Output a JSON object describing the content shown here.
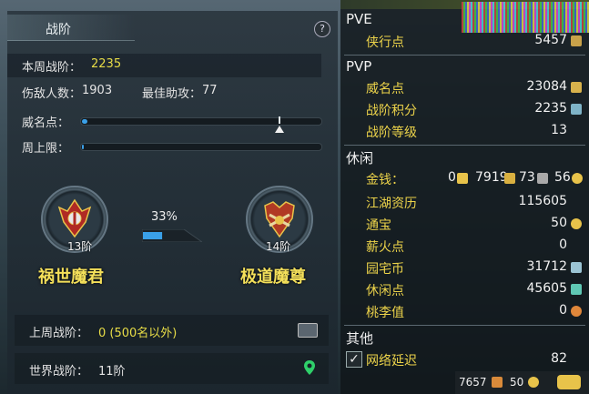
{
  "rank": {
    "title": "战阶",
    "help": "?",
    "this_week_label": "本周战阶：",
    "this_week_value": "2235",
    "kills_label": "伤敌人数：",
    "kills_value": "1903",
    "assists_label": "最佳助攻：",
    "assists_value": "77",
    "prestige_label": "威名点：",
    "weekly_cap_label": "周上限：",
    "left_tier": "13阶",
    "left_name": "祸世魔君",
    "right_tier": "14阶",
    "right_name": "极道魔尊",
    "progress_pct": "33%",
    "progress_fraction": 0.33,
    "last_week_label": "上周战阶：",
    "last_week_value": "0 (500名以外)",
    "world_label": "世界战阶：",
    "world_value": "11阶"
  },
  "stats": {
    "pve_title": "PVE",
    "pve_rows": [
      {
        "label": "侠行点",
        "value": "5457"
      }
    ],
    "pvp_title": "PVP",
    "pvp_rows": [
      {
        "label": "威名点",
        "value": "23084"
      },
      {
        "label": "战阶积分",
        "value": "2235"
      },
      {
        "label": "战阶等级",
        "value": "13"
      }
    ],
    "leisure_title": "休闲",
    "money_label": "金钱：",
    "money_values": [
      "0",
      "7919",
      "73",
      "56"
    ],
    "leisure_rows": [
      {
        "label": "江湖资历",
        "value": "115605"
      },
      {
        "label": "通宝",
        "value": "50"
      },
      {
        "label": "薪火点",
        "value": "0"
      },
      {
        "label": "园宅币",
        "value": "31712"
      },
      {
        "label": "休闲点",
        "value": "45605"
      },
      {
        "label": "桃李值",
        "value": "0"
      }
    ],
    "other_title": "其他",
    "latency_label": "网络延迟",
    "latency_value": "82",
    "latency_checked": "✓",
    "bottom_left_value": "7657",
    "bottom_right_value": "50"
  },
  "colors": {
    "accent_yellow": "#ecd34a",
    "bar_blue": "#3aa0e8"
  }
}
